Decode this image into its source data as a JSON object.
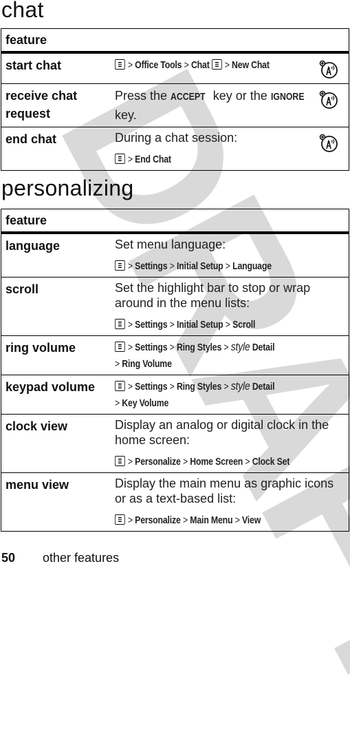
{
  "watermark": "DRAFT",
  "sections": {
    "chat": {
      "title": "chat",
      "header": "feature",
      "rows": [
        {
          "feature": "start chat",
          "path": [
            "Office Tools",
            "Chat",
            "New Chat"
          ],
          "network_icon": true
        },
        {
          "feature_lines": [
            "receive chat",
            "request"
          ],
          "text": "Press the",
          "key1": "ACCEPT",
          "text2": "key or the",
          "key2": "IGNORE",
          "text3": "key.",
          "network_icon": true
        },
        {
          "feature": "end chat",
          "text": "During a chat session:",
          "path": [
            "End Chat"
          ],
          "network_icon": true
        }
      ]
    },
    "personalizing": {
      "title": "personalizing",
      "header": "feature",
      "rows": [
        {
          "feature": "language",
          "text": "Set menu language:",
          "path": [
            "Settings",
            "Initial Setup",
            "Language"
          ]
        },
        {
          "feature": "scroll",
          "text": "Set the highlight bar to stop or wrap around in the menu lists:",
          "path": [
            "Settings",
            "Initial Setup",
            "Scroll"
          ]
        },
        {
          "feature": "ring volume",
          "path": [
            "Settings",
            "Ring Styles"
          ],
          "style_word": "style",
          "detail": "Detail",
          "path_end": "Ring Volume"
        },
        {
          "feature": "keypad volume",
          "path": [
            "Settings",
            "Ring Styles"
          ],
          "style_word": "style",
          "detail": "Detail",
          "path_end": "Key Volume"
        },
        {
          "feature": "clock view",
          "text": "Display an analog or digital clock in the home screen:",
          "path": [
            "Personalize",
            "Home Screen",
            "Clock Set"
          ]
        },
        {
          "feature": "menu view",
          "text": "Display the main menu as graphic icons or as a text-based list:",
          "path": [
            "Personalize",
            "Main Menu",
            "View"
          ]
        }
      ]
    }
  },
  "icons": {
    "menu_key": "menu-key-icon",
    "network": "network-feature-icon",
    "separator": ">"
  },
  "footer": {
    "page_number": "50",
    "section": "other features"
  }
}
